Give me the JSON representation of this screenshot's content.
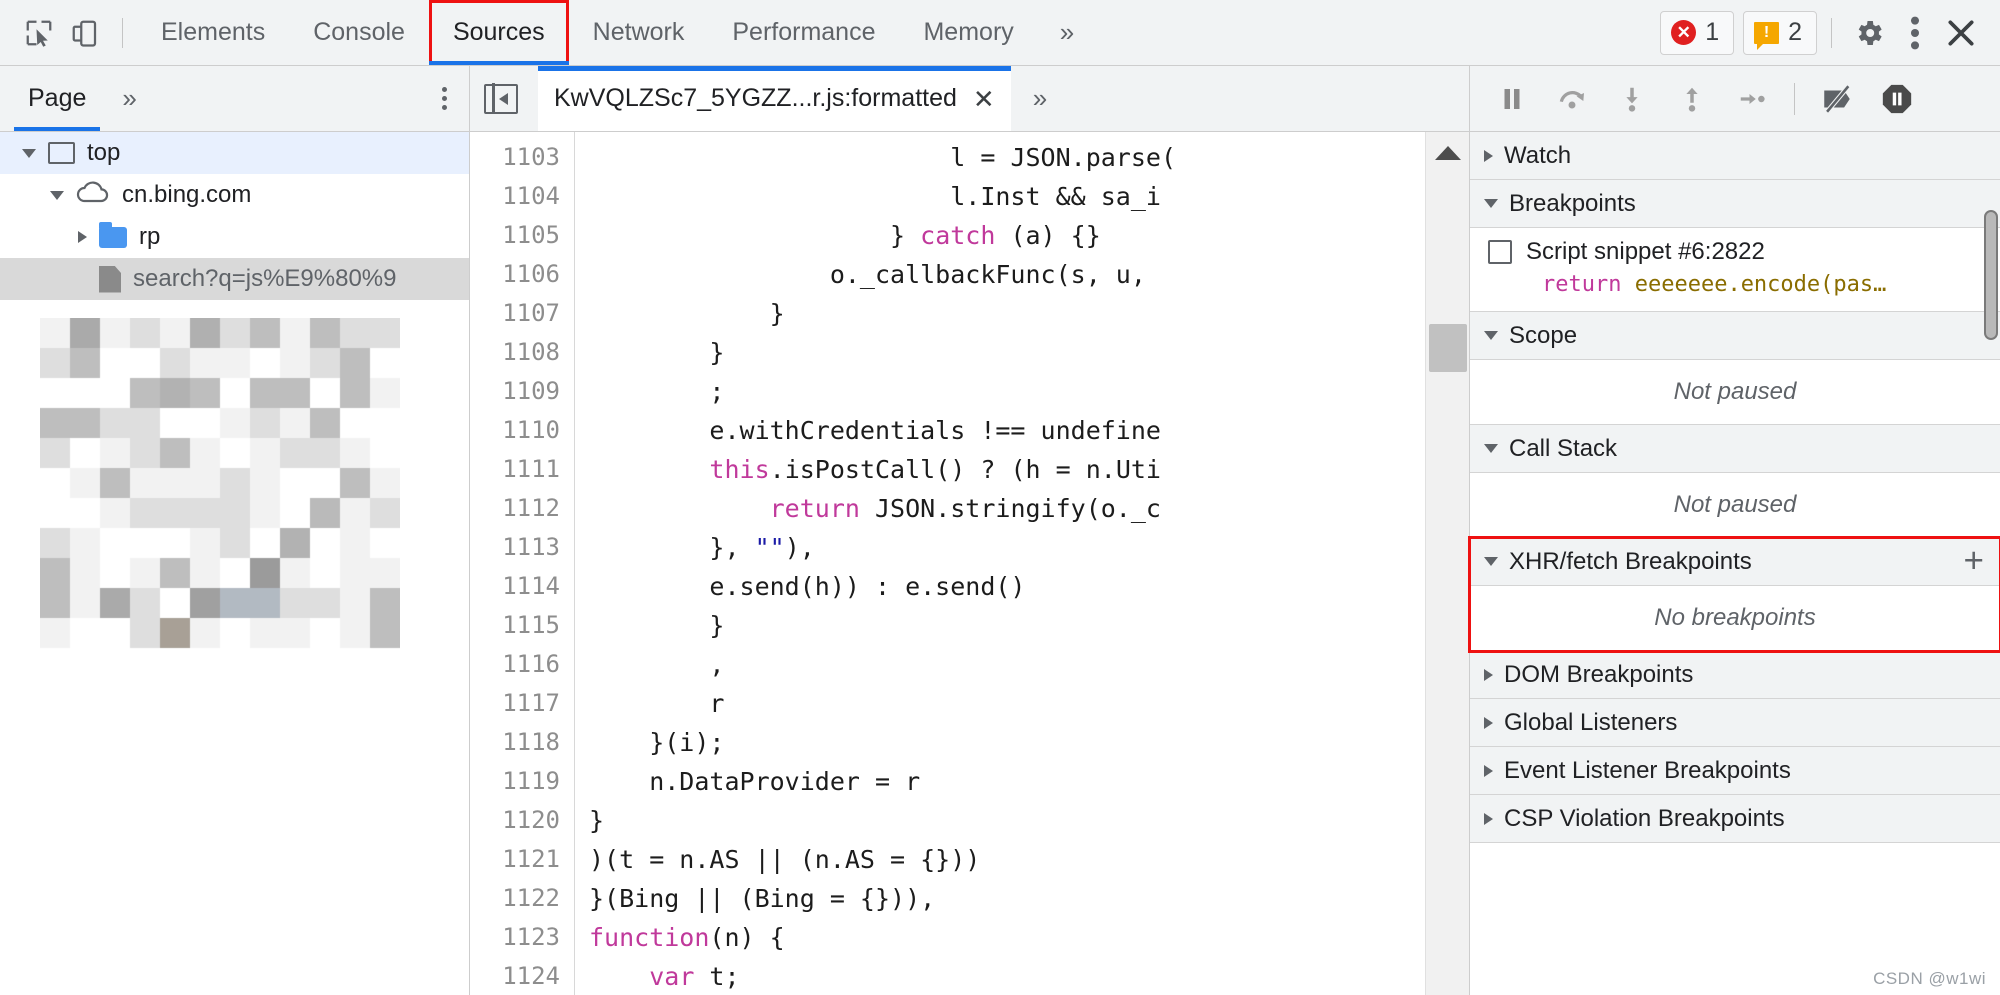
{
  "toolbar": {
    "inspect_icon": "inspect-element-icon",
    "device_icon": "device-toolbar-icon",
    "tabs": [
      {
        "label": "Elements",
        "active": false
      },
      {
        "label": "Console",
        "active": false
      },
      {
        "label": "Sources",
        "active": true,
        "highlighted": true
      },
      {
        "label": "Network",
        "active": false
      },
      {
        "label": "Performance",
        "active": false
      },
      {
        "label": "Memory",
        "active": false
      }
    ],
    "more_tabs": "»",
    "error_count": "1",
    "warning_count": "2",
    "error_glyph": "✕",
    "warning_glyph": "!",
    "settings_icon": "gear-icon",
    "kebab_icon": "more-options-icon",
    "close_icon": "close-icon"
  },
  "navigator": {
    "tab_label": "Page",
    "more_label": "»",
    "tree": [
      {
        "label": "top",
        "icon": "frame-icon",
        "depth": 0,
        "twisty": "open",
        "state": "selected-blue"
      },
      {
        "label": "cn.bing.com",
        "icon": "cloud-icon",
        "depth": 1,
        "twisty": "open",
        "state": "none"
      },
      {
        "label": "rp",
        "icon": "folder-icon",
        "depth": 2,
        "twisty": "closed",
        "state": "none"
      },
      {
        "label": "search?q=js%E9%80%9",
        "icon": "file-icon",
        "depth": 2,
        "twisty": "none",
        "state": "selected-grey"
      }
    ]
  },
  "editor": {
    "panel_toggle_icon": "show-navigator-icon",
    "tab_name": "KwVQLZSc7_5YGZZ...r.js:formatted",
    "tab_close_glyph": "✕",
    "more_tabs_glyph": "»",
    "first_line_number": 1103,
    "lines": [
      {
        "n": "1103",
        "html": "                        l = <span class=\"pl\">JSON</span>.parse("
      },
      {
        "n": "1104",
        "html": "                        l.Inst &amp;&amp; sa_i"
      },
      {
        "n": "1105",
        "html": "                    } <span class=\"kw\">catch</span> (a) {}"
      },
      {
        "n": "1106",
        "html": "                o._callbackFunc(s, u, "
      },
      {
        "n": "1107",
        "html": "            }"
      },
      {
        "n": "1108",
        "html": "        }"
      },
      {
        "n": "1109",
        "html": "        ;"
      },
      {
        "n": "1110",
        "html": "        e.withCredentials !== undefine"
      },
      {
        "n": "1111",
        "html": "        <span class=\"kw\">this</span>.isPostCall() ? (h = n.Uti"
      },
      {
        "n": "1112",
        "html": "            <span class=\"kw\">return</span> JSON.stringify(o._c"
      },
      {
        "n": "1113",
        "html": "        }, <span class=\"str\">\"\"</span>),"
      },
      {
        "n": "1114",
        "html": "        e.send(h)) : e.send()"
      },
      {
        "n": "1115",
        "html": "        }"
      },
      {
        "n": "1116",
        "html": "        ,"
      },
      {
        "n": "1117",
        "html": "        r"
      },
      {
        "n": "1118",
        "html": "    }(i);"
      },
      {
        "n": "1119",
        "html": "    n.DataProvider = r"
      },
      {
        "n": "1120",
        "html": "}"
      },
      {
        "n": "1121",
        "html": ")(t = n.AS || (n.AS = {}))"
      },
      {
        "n": "1122",
        "html": "}(Bing || (Bing = {})),"
      },
      {
        "n": "1123",
        "html": "<span class=\"kw\">function</span>(n) {"
      },
      {
        "n": "1124",
        "html": "    <span class=\"kw\">var</span> t;"
      }
    ],
    "scrollbar": "vertical-scrollbar"
  },
  "debugger": {
    "controls": [
      {
        "name": "resume-script-execution-icon",
        "glyph": "pause"
      },
      {
        "name": "step-over-next-function-call-icon",
        "glyph": "step-over"
      },
      {
        "name": "step-into-next-function-call-icon",
        "glyph": "step-into"
      },
      {
        "name": "step-out-of-current-function-icon",
        "glyph": "step-out"
      },
      {
        "name": "step-icon",
        "glyph": "step"
      },
      {
        "name": "deactivate-breakpoints-icon",
        "glyph": "deactivate"
      },
      {
        "name": "pause-on-exceptions-icon",
        "glyph": "pause-on-exceptions"
      }
    ],
    "sections": [
      {
        "title": "Watch",
        "expanded": false,
        "body": null,
        "plus": false,
        "highlighted": false
      },
      {
        "title": "Breakpoints",
        "expanded": true,
        "body": "breakpoint-list",
        "plus": false,
        "highlighted": false
      },
      {
        "title": "Scope",
        "expanded": true,
        "body": "Not paused",
        "plus": false,
        "highlighted": false
      },
      {
        "title": "Call Stack",
        "expanded": true,
        "body": "Not paused",
        "plus": false,
        "highlighted": false
      },
      {
        "title": "XHR/fetch Breakpoints",
        "expanded": true,
        "body": "No breakpoints",
        "plus": true,
        "highlighted": true
      },
      {
        "title": "DOM Breakpoints",
        "expanded": false,
        "body": null,
        "plus": false,
        "highlighted": false
      },
      {
        "title": "Global Listeners",
        "expanded": false,
        "body": null,
        "plus": false,
        "highlighted": false
      },
      {
        "title": "Event Listener Breakpoints",
        "expanded": false,
        "body": null,
        "plus": false,
        "highlighted": false
      },
      {
        "title": "CSP Violation Breakpoints",
        "expanded": false,
        "body": null,
        "plus": false,
        "highlighted": false
      }
    ],
    "breakpoint": {
      "checked": false,
      "label": "Script snippet #6:2822",
      "snippet_kw": "return",
      "snippet_rest": " eeeeeee.encode(pas…"
    },
    "add_xhr_plus": "+"
  },
  "watermark": "CSDN @w1wi",
  "colors": {
    "accent_blue": "#1a73e8",
    "highlight_red": "#ee1111",
    "toolbar_bg": "#f1f3f4",
    "error_red": "#e02020",
    "warning_orange": "#f5a700",
    "folder_blue": "#4a97f0"
  }
}
